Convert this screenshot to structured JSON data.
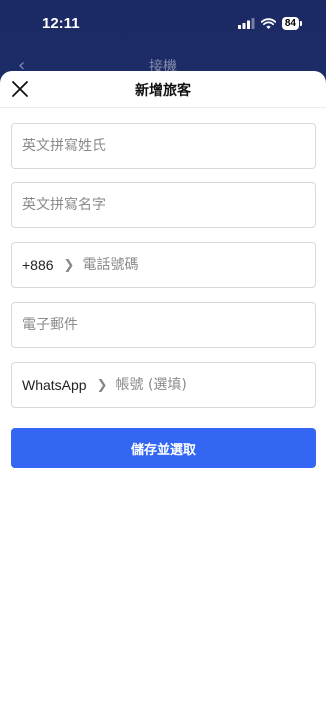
{
  "status_bar": {
    "time": "12:11",
    "battery": "84"
  },
  "background_page": {
    "title": "接機"
  },
  "sheet": {
    "title": "新增旅客",
    "fields": {
      "last_name": {
        "placeholder": "英文拼寫姓氏",
        "value": ""
      },
      "first_name": {
        "placeholder": "英文拼寫名字",
        "value": ""
      },
      "phone": {
        "prefix": "+886",
        "placeholder": "電話號碼",
        "value": ""
      },
      "email": {
        "placeholder": "電子郵件",
        "value": ""
      },
      "whatsapp": {
        "prefix": "WhatsApp",
        "placeholder": "帳號 (選填)",
        "value": ""
      }
    },
    "submit_label": "儲存並選取"
  },
  "colors": {
    "primary": "#3366f2",
    "header_bg": "#1f2f6b"
  }
}
